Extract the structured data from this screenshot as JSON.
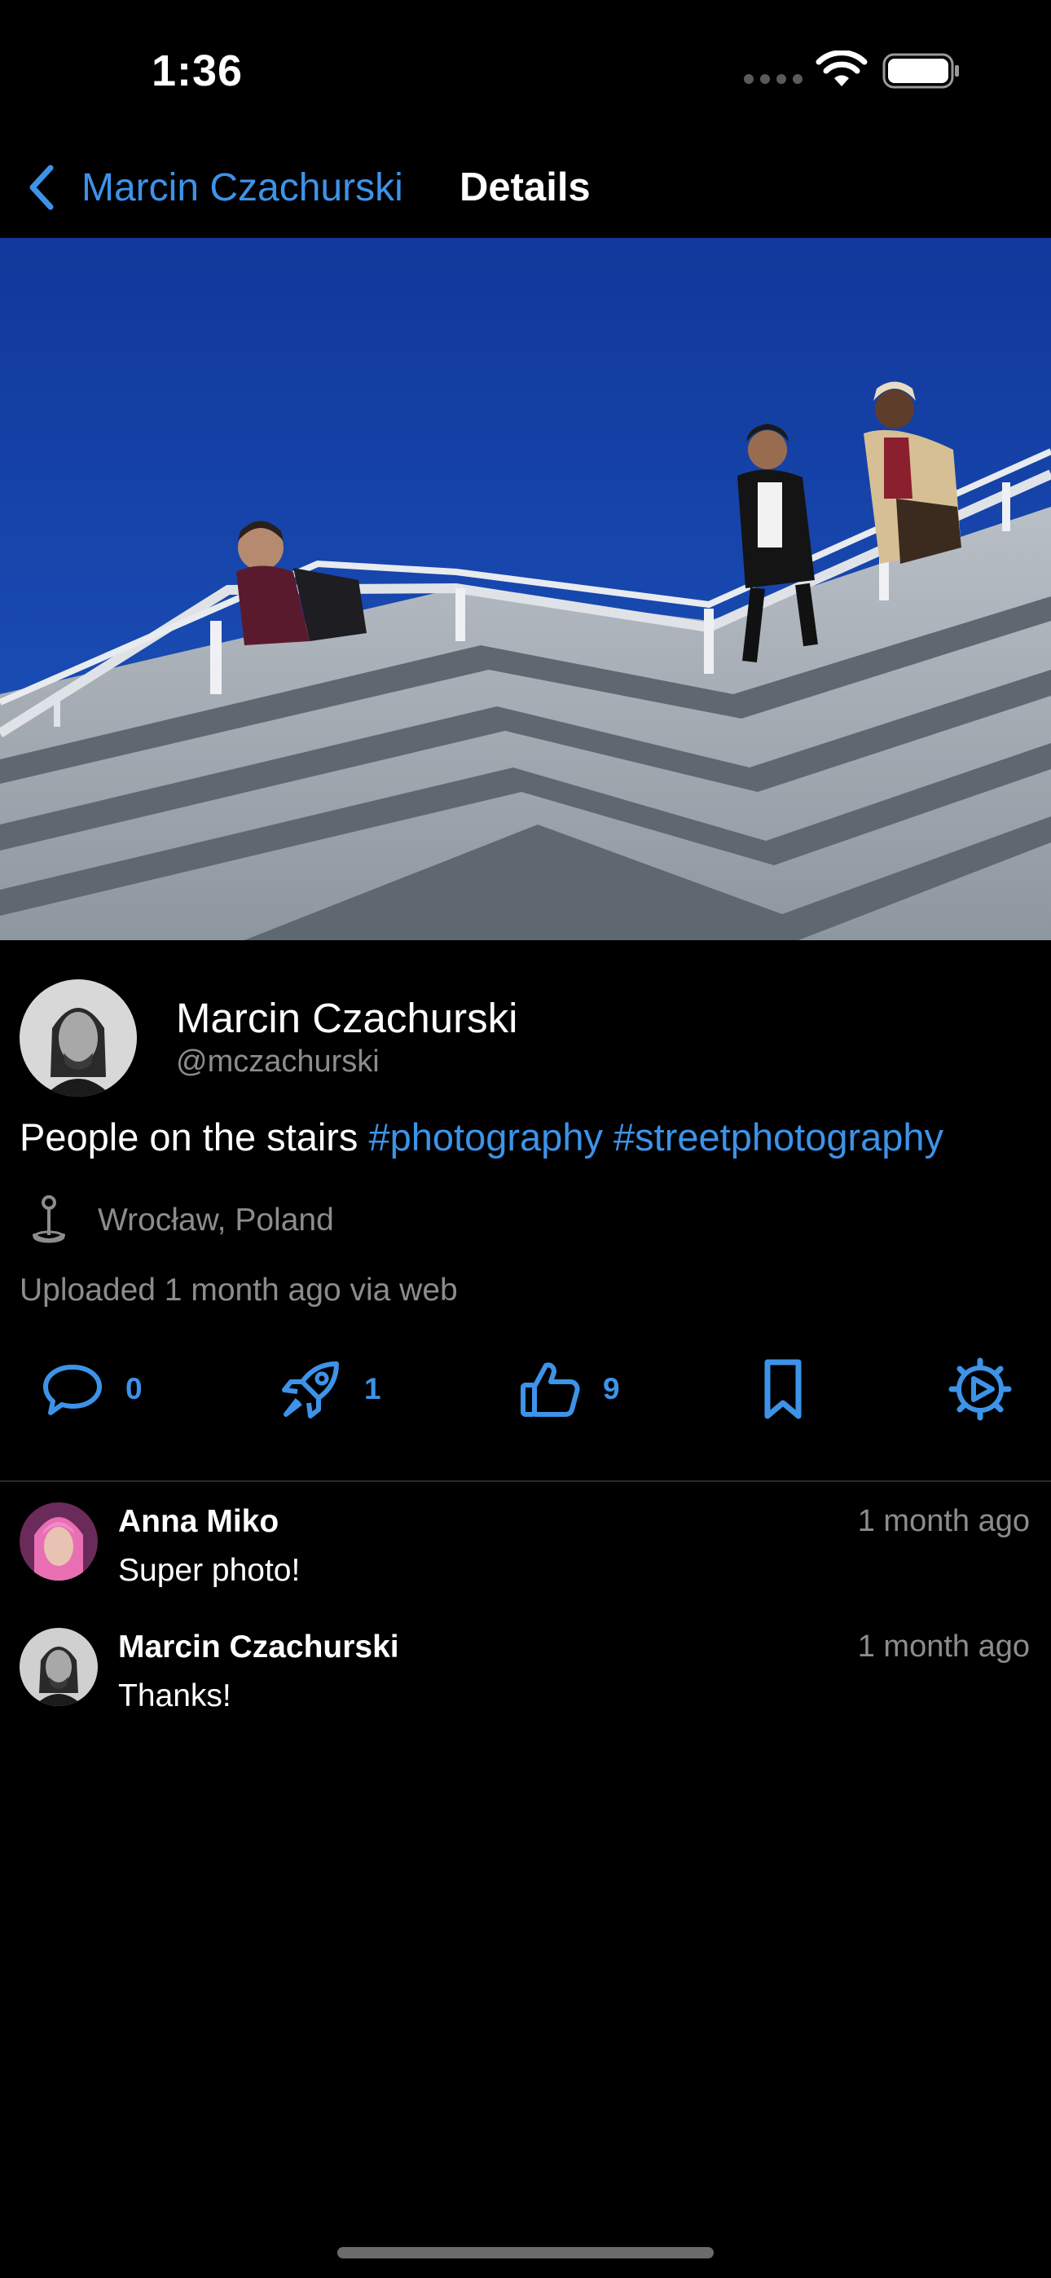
{
  "status_bar": {
    "time": "1:36"
  },
  "nav": {
    "back_label": "Marcin Czachurski",
    "title": "Details"
  },
  "post": {
    "author_name": "Marcin Czachurski",
    "author_handle": "@mczachurski",
    "caption_text": "People on the stairs",
    "hashtags": [
      "#photography",
      "#streetphotography"
    ],
    "location": "Wrocław, Poland",
    "uploaded": "Uploaded 1 month ago via web"
  },
  "actions": {
    "comments_count": "0",
    "boosts_count": "1",
    "likes_count": "9"
  },
  "comments": [
    {
      "author": "Anna Miko",
      "time": "1 month ago",
      "text": "Super photo!"
    },
    {
      "author": "Marcin Czachurski",
      "time": "1 month ago",
      "text": "Thanks!"
    }
  ],
  "colors": {
    "accent": "#3d93e8",
    "background": "#000000",
    "secondary_text": "#8c8c8c",
    "divider": "#2b2b2b"
  },
  "icons": {
    "back": "chevron-left-icon",
    "location": "map-pin-icon",
    "comment": "speech-bubble-icon",
    "boost": "rocket-icon",
    "like": "thumbs-up-icon",
    "bookmark": "bookmark-icon",
    "menu": "gear-play-icon"
  }
}
